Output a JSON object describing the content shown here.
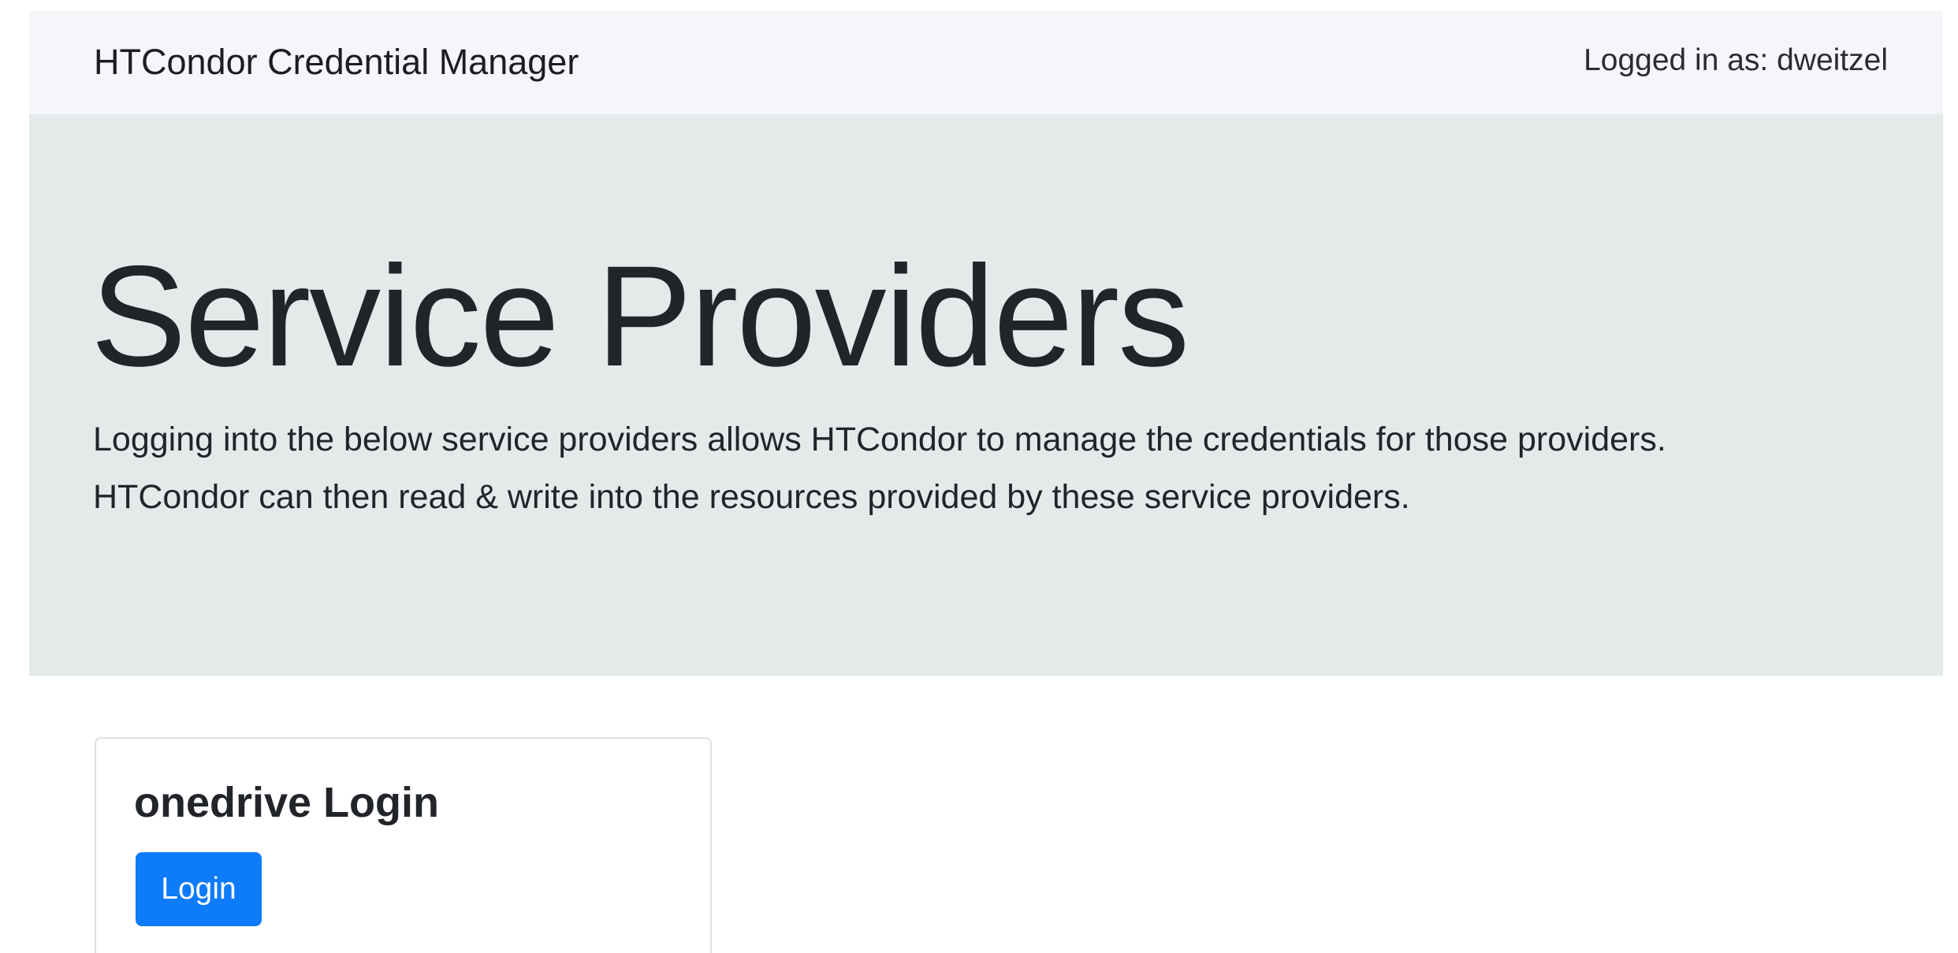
{
  "navbar": {
    "brand": "HTCondor Credential Manager",
    "user_info": "Logged in as: dweitzel",
    "background": "#f5f5fa"
  },
  "jumbotron": {
    "title": "Service Providers",
    "lead_line_1": "Logging into the below service providers allows HTCondor to manage the credentials for those providers.",
    "lead_line_2": "HTCondor can then read & write into the resources provided by these service providers.",
    "background": "#e4eaea"
  },
  "providers": [
    {
      "title": "onedrive Login",
      "button_label": "Login",
      "button_color": "#0d7bfa"
    }
  ]
}
